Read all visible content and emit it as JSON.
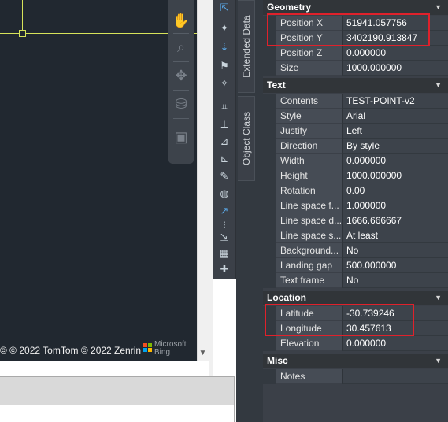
{
  "viewport": {
    "attribution": "© © 2022 TomTom © 2022 Zenrin",
    "ms_logo_text": [
      "Microsoft",
      "Bing"
    ],
    "ms_colors": [
      "#f25022",
      "#7fba00",
      "#00a4ef",
      "#ffb900"
    ]
  },
  "navbar": {
    "tools": [
      "pan-icon",
      "zoom-icon",
      "orbit-icon",
      "showmotion-icon",
      "recorder-icon"
    ],
    "glyphs": [
      "✋",
      "⌕",
      "✥",
      "⛁",
      "▣"
    ]
  },
  "palette": {
    "glyphs": [
      "⇱",
      "✦",
      "⇣",
      "⚑",
      "✧",
      "⌗",
      "⟂",
      "⊿",
      "⊾",
      "✎",
      "◍",
      "↗",
      "⁝",
      "⇲",
      "▦",
      "✚"
    ]
  },
  "tabs": {
    "extended_data": "Extended Data",
    "object_class": "Object Class"
  },
  "sections": {
    "geometry": {
      "title": "Geometry",
      "rows": [
        {
          "label": "Position X",
          "value": "51941.057756"
        },
        {
          "label": "Position Y",
          "value": "3402190.913847"
        },
        {
          "label": "Position Z",
          "value": "0.000000"
        },
        {
          "label": "Size",
          "value": "1000.000000"
        }
      ]
    },
    "text": {
      "title": "Text",
      "rows": [
        {
          "label": "Contents",
          "value": "TEST-POINT-v2"
        },
        {
          "label": "Style",
          "value": "Arial"
        },
        {
          "label": "Justify",
          "value": "Left"
        },
        {
          "label": "Direction",
          "value": "By style"
        },
        {
          "label": "Width",
          "value": "0.000000"
        },
        {
          "label": "Height",
          "value": "1000.000000"
        },
        {
          "label": "Rotation",
          "value": "0.00"
        },
        {
          "label": "Line space f...",
          "value": "1.000000"
        },
        {
          "label": "Line space d...",
          "value": "1666.666667"
        },
        {
          "label": "Line space s...",
          "value": "At least"
        },
        {
          "label": "Background...",
          "value": "No"
        },
        {
          "label": "Landing gap",
          "value": "500.000000"
        },
        {
          "label": "Text frame",
          "value": "No"
        }
      ]
    },
    "location": {
      "title": "Location",
      "rows": [
        {
          "label": "Latitude",
          "value": "-30.739246"
        },
        {
          "label": "Longitude",
          "value": "30.457613"
        },
        {
          "label": "Elevation",
          "value": "0.000000"
        }
      ]
    },
    "misc": {
      "title": "Misc",
      "rows": [
        {
          "label": "Notes",
          "value": ""
        }
      ]
    }
  },
  "highlight_color": "#e0212b"
}
